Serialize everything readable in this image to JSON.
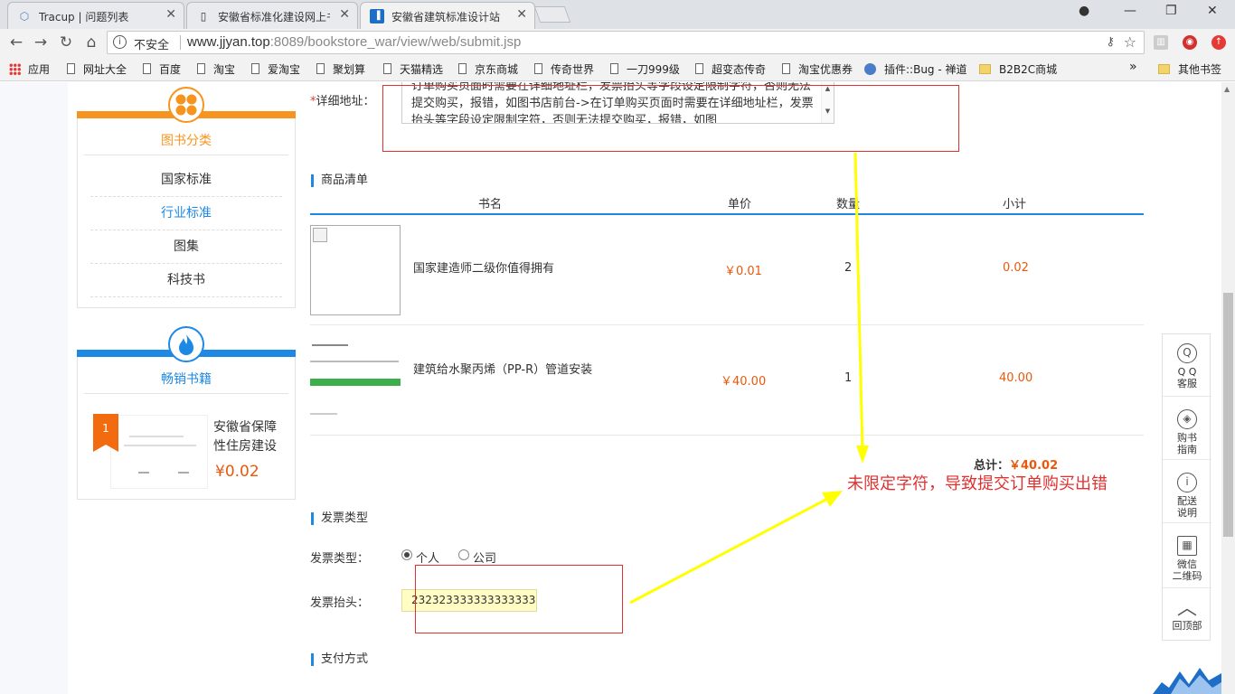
{
  "browser": {
    "tabs": [
      {
        "title": "Tracup | 问题列表",
        "icon": "tracup-icon"
      },
      {
        "title": "安徽省标准化建设网上书",
        "icon": "doc-icon"
      },
      {
        "title": "安徽省建筑标准设计站",
        "icon": "bookmark-icon"
      }
    ],
    "close_glyph": "✕",
    "omnibox": {
      "security": "不安全",
      "host": "www.jjyan.top",
      "path": ":8089/bookstore_war/view/web/submit.jsp"
    },
    "bookmarks": [
      "应用",
      "网址大全",
      "百度",
      "淘宝",
      "爱淘宝",
      "聚划算",
      "天猫精选",
      "京东商城",
      "传奇世界",
      "一刀999级",
      "超变态传奇",
      "淘宝优惠券",
      "插件::Bug - 禅道",
      "B2B2C商城"
    ],
    "bookmarks_more": "»",
    "other_bookmarks": "其他书签"
  },
  "sidebar": {
    "category_title": "图书分类",
    "categories": [
      "国家标准",
      "行业标准",
      "图集",
      "科技书"
    ],
    "active_category_index": 1,
    "bestseller_title": "畅销书籍",
    "bestseller": {
      "rank": "1",
      "name": "安徽省保障性住房建设",
      "price": "¥0.02"
    }
  },
  "address": {
    "label": "*详细地址：",
    "required_mark": "*",
    "label_text": "详细地址：",
    "value": "订单购买页面时需要在详细地址栏，发票抬头等字段设定限制字符，否则无法提交购买，报错，如图书店前台->在订单购买页面时需要在详细地址栏，发票抬头等字段设定限制字符，否则无法提交购买，报错，如图"
  },
  "goods": {
    "section_title": "商品清单",
    "headers": {
      "name": "书名",
      "unit_price": "单价",
      "qty": "数量",
      "subtotal": "小计"
    },
    "rows": [
      {
        "name": "国家建造师二级你值得拥有",
        "unit_price": "￥0.01",
        "qty": "2",
        "subtotal": "0.02"
      },
      {
        "name": "建筑给水聚丙烯（PP-R）管道安装",
        "unit_price": "￥40.00",
        "qty": "1",
        "subtotal": "40.00"
      }
    ],
    "total_label": "总计：",
    "total_value": "￥40.02"
  },
  "annotation": "未限定字符，导致提交订单购买出错",
  "invoice": {
    "section_title": "发票类型",
    "type_label": "发票类型：",
    "options": [
      "个人",
      "公司"
    ],
    "selected": "个人",
    "header_label": "发票抬头：",
    "header_value": "232323333333333333"
  },
  "payment": {
    "section_title": "支付方式"
  },
  "float_panel": [
    {
      "label": "Q Q\n客服",
      "icon": "qq-icon"
    },
    {
      "label": "购书\n指南",
      "icon": "compass-icon"
    },
    {
      "label": "配送\n说明",
      "icon": "info-icon"
    },
    {
      "label": "微信\n二维码",
      "icon": "qrcode-icon"
    },
    {
      "label": "回顶部",
      "icon": "chevron-up-icon"
    }
  ],
  "colors": {
    "accent_blue": "#1e88e5",
    "accent_orange": "#f7941d",
    "price_orange": "#e8590c",
    "annotation_red": "#e03131",
    "arrow_yellow": "#ffff00"
  }
}
